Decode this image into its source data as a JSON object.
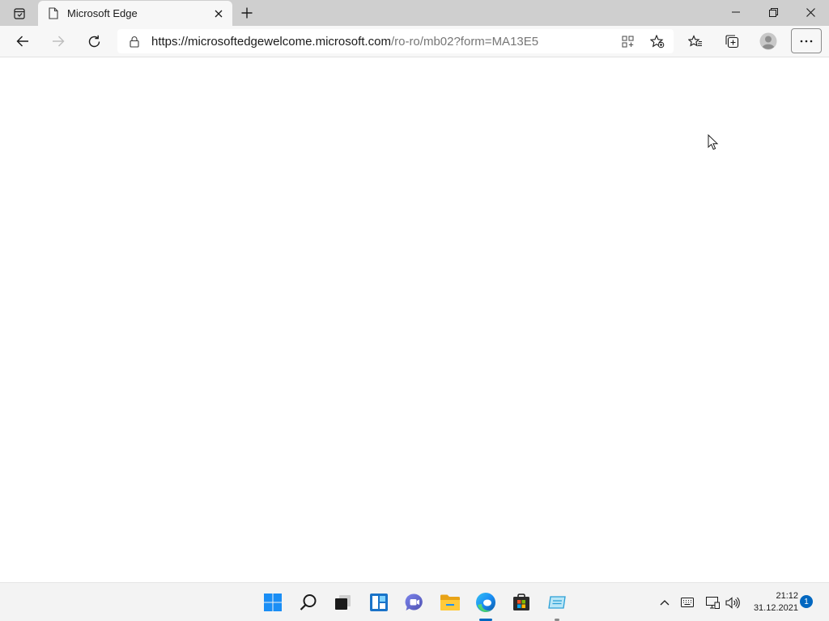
{
  "browser": {
    "tab": {
      "title": "Microsoft Edge"
    },
    "address_bar": {
      "url_host": "https://microsoftedgewelcome.microsoft.com",
      "url_path": "/ro-ro/mb02?form=MA13E5"
    },
    "icons": {
      "tab_actions": "tab-actions-icon",
      "favicon": "page-icon",
      "close_tab": "close-icon",
      "new_tab": "plus-icon",
      "back": "back-arrow-icon",
      "forward": "forward-arrow-icon",
      "refresh": "refresh-icon",
      "lock": "lock-icon",
      "app_available": "app-available-icon",
      "add_favorite": "add-favorite-icon",
      "favorites": "favorites-icon",
      "collections": "collections-icon",
      "profile": "profile-icon",
      "more": "more-icon"
    }
  },
  "window_controls": {
    "minimize": "minimize-icon",
    "restore": "restore-icon",
    "close": "close-icon"
  },
  "taskbar": {
    "apps": [
      {
        "name": "Start",
        "icon": "windows-start-icon"
      },
      {
        "name": "Search",
        "icon": "search-icon"
      },
      {
        "name": "Task View",
        "icon": "task-view-icon"
      },
      {
        "name": "Widgets",
        "icon": "widgets-icon"
      },
      {
        "name": "Chat",
        "icon": "chat-icon"
      },
      {
        "name": "File Explorer",
        "icon": "folder-icon"
      },
      {
        "name": "Microsoft Edge",
        "icon": "edge-icon"
      },
      {
        "name": "Microsoft Store",
        "icon": "store-icon"
      },
      {
        "name": "Settings Server",
        "icon": "server-app-icon"
      }
    ],
    "tray": {
      "icons": [
        "chevron-up-icon",
        "keyboard-icon",
        "network-icon",
        "volume-icon"
      ],
      "time": "21:12",
      "date": "31.12.2021",
      "notification_count": "1"
    }
  },
  "colors": {
    "accent": "#0067c0",
    "tabstrip": "#cfcfcf",
    "toolbar": "#f7f7f7"
  }
}
